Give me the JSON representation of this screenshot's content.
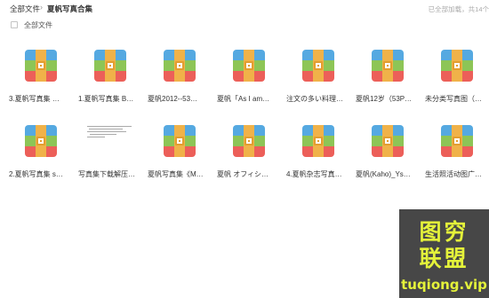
{
  "breadcrumb": {
    "root": "全部文件",
    "separator": "›",
    "current": "夏帆写真合集"
  },
  "status_text": "已全部加载，共14个",
  "select_all_label": "全部文件",
  "files": [
    {
      "name": "3.夏帆写真集 …",
      "icon": "archive-icon"
    },
    {
      "name": "1.夏帆写真集 B…",
      "icon": "archive-icon"
    },
    {
      "name": "夏帆2012--53…",
      "icon": "archive-icon"
    },
    {
      "name": "夏帆「As I am…",
      "icon": "archive-icon"
    },
    {
      "name": "注文の多い料理…",
      "icon": "archive-icon"
    },
    {
      "name": "夏帆12岁（53P…",
      "icon": "archive-icon"
    },
    {
      "name": "未分类写真图（…",
      "icon": "archive-icon"
    },
    {
      "name": "2.夏帆写真集 s…",
      "icon": "archive-icon"
    },
    {
      "name": "写真集下载解压…",
      "icon": "document-thumbnail"
    },
    {
      "name": "夏帆写真集《M…",
      "icon": "archive-icon"
    },
    {
      "name": "夏帆 オフィシ…",
      "icon": "archive-icon"
    },
    {
      "name": "4.夏帆杂志写真…",
      "icon": "archive-icon"
    },
    {
      "name": "夏帆(Kaho)_Ys…",
      "icon": "archive-icon"
    },
    {
      "name": "生活照活动图广…",
      "icon": "archive-icon"
    }
  ],
  "watermark": {
    "line1": "图穷",
    "line2": "联盟",
    "url": "tuqiong.vip"
  },
  "colors": {
    "archive_blue": "#55a9e1",
    "archive_green": "#8dc556",
    "archive_red": "#ec5f59",
    "archive_zip": "#f0b249",
    "watermark_bg": "#474747",
    "watermark_text": "#e4f23a"
  }
}
